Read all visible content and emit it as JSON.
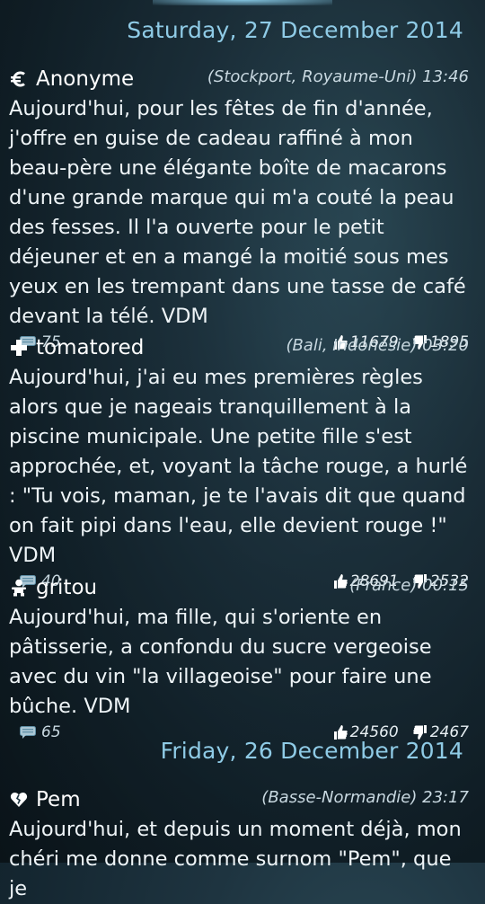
{
  "sections": [
    {
      "date": "Saturday, 27 December 2014",
      "posts": [
        {
          "author": "Anonyme",
          "author_icon": "euro-icon",
          "meta": "(Stockport, Royaume-Uni) 13:46",
          "text": "Aujourd'hui, pour les fêtes de fin d'année, j'offre en guise de cadeau raffiné à mon beau-père une élégante boîte de macarons d'une grande marque qui m'a couté la peau des fesses. Il l'a ouverte pour le petit déjeuner et en a mangé la moitié sous mes yeux en les trempant dans une tasse de café devant la télé. VDM",
          "comments": "75",
          "upvotes": "11679",
          "downvotes": "1895"
        },
        {
          "author": "tomatored",
          "author_icon": "cross-icon",
          "meta": "(Bali, Indonésie) 03:20",
          "text": "Aujourd'hui, j'ai eu mes premières règles alors que je nageais tranquillement à la piscine municipale. Une petite fille s'est approchée, et, voyant la tâche rouge, a hurlé : \"Tu vois, maman, je te l'avais dit que quand on fait pipi dans l'eau, elle devient rouge !\" VDM",
          "comments": "40",
          "upvotes": "28691",
          "downvotes": "2532"
        },
        {
          "author": "gritou",
          "author_icon": "baby-icon",
          "meta": "(France) 00:15",
          "text": "Aujourd'hui, ma fille, qui s'oriente en pâtisserie, a confondu du sucre vergeoise avec du vin \"la villageoise\" pour faire une bûche. VDM",
          "comments": "65",
          "upvotes": "24560",
          "downvotes": "2467"
        }
      ]
    },
    {
      "date": "Friday, 26 December 2014",
      "posts": [
        {
          "author": "Pem",
          "author_icon": "broken-heart-icon",
          "meta": "(Basse-Normandie) 23:17",
          "text": "Aujourd'hui, et depuis un moment déjà, mon chéri me donne comme surnom \"Pem\", que je"
        }
      ]
    }
  ]
}
